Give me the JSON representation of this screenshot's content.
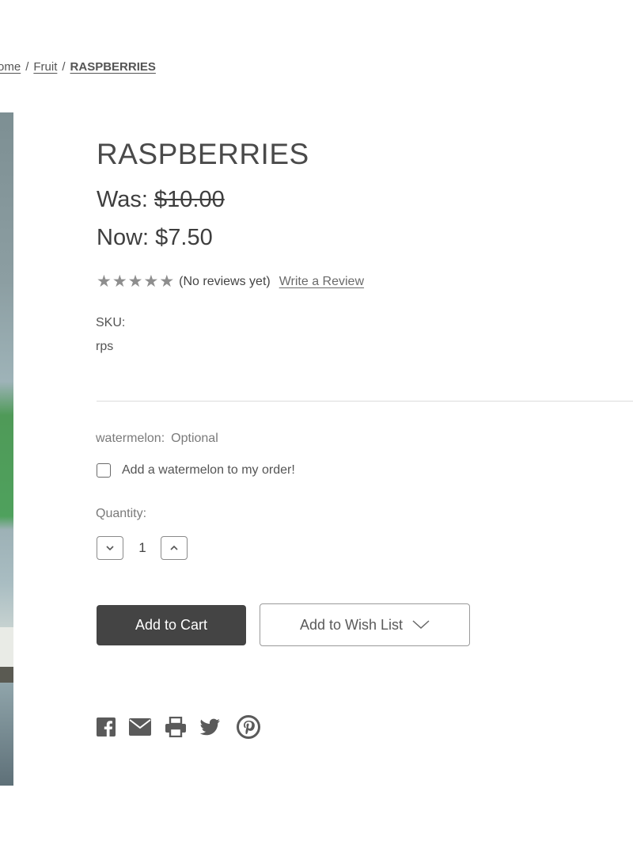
{
  "breadcrumb": {
    "items": [
      {
        "label": "ome"
      },
      {
        "label": "Fruit"
      },
      {
        "label": "RASPBERRIES"
      }
    ],
    "separator": "/"
  },
  "product": {
    "title": "RASPBERRIES",
    "was_label": "Was:",
    "was_price": "$10.00",
    "now_label": "Now:",
    "now_price": "$7.50",
    "rating": {
      "stars": 5,
      "reviews_text": "(No reviews yet)",
      "write_review_label": "Write a Review"
    },
    "sku_label": "SKU:",
    "sku_value": "rps"
  },
  "option": {
    "name": "watermelon:",
    "optional_text": "Optional",
    "checkbox_label": "Add a watermelon to my order!",
    "checked": false
  },
  "quantity": {
    "label": "Quantity:",
    "value": "1"
  },
  "actions": {
    "add_to_cart_label": "Add to Cart",
    "add_to_wishlist_label": "Add to Wish List"
  },
  "share_icons": [
    "facebook-icon",
    "email-icon",
    "print-icon",
    "twitter-icon",
    "pinterest-icon"
  ],
  "colors": {
    "primary_button": "#444444",
    "text": "#444444",
    "icon": "#5a5a5a"
  }
}
